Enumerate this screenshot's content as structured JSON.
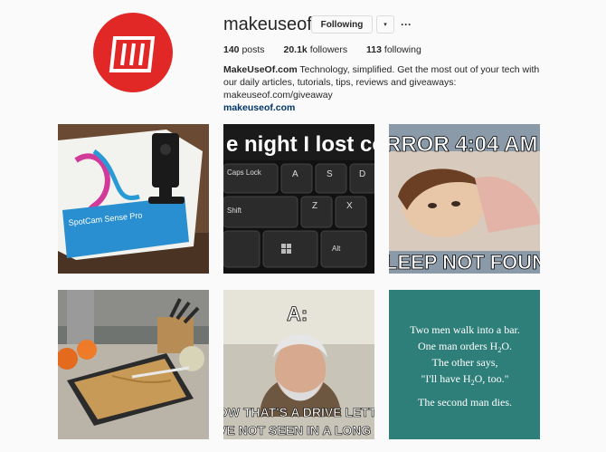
{
  "profile": {
    "username": "makeuseof",
    "follow_label": "Following",
    "dropdown_icon": "▾",
    "more_icon": "···",
    "stats": {
      "posts_count": "140",
      "posts_label": "posts",
      "followers_count": "20.1k",
      "followers_label": "followers",
      "following_count": "113",
      "following_label": "following"
    },
    "bio": {
      "name": "MakeUseOf.com",
      "text": " Technology, simplified. Get the most out of your tech with our daily articles, tutorials, tips, reviews and giveaways: makeuseof.com/giveaway",
      "link": "makeuseof.com"
    }
  },
  "posts": [
    {
      "caption_lines": [
        "SpotCam Sense Pro"
      ]
    },
    {
      "caption_lines": [
        "e night I lost contr",
        "Caps Lock",
        "A",
        "S",
        "D",
        "Z",
        "X",
        "Shift",
        "Alt"
      ]
    },
    {
      "caption_lines": [
        "RROR 4:04 AM",
        "LEEP NOT FOUN"
      ]
    },
    {
      "caption_lines": []
    },
    {
      "caption_lines": [
        "A:",
        "OW THAT'S A DRIVE LETTER",
        "VE NOT SEEN IN A LONG TI"
      ]
    },
    {
      "caption_lines": [
        "Two men walk into a bar.",
        "One man orders H",
        "2",
        "O.",
        "The other says,",
        "\"I'll have H",
        "2",
        "O, too.\"",
        "The second man dies."
      ]
    }
  ],
  "colors": {
    "brand_red": "#e22727",
    "teal": "#2e7f79",
    "link": "#003569"
  }
}
